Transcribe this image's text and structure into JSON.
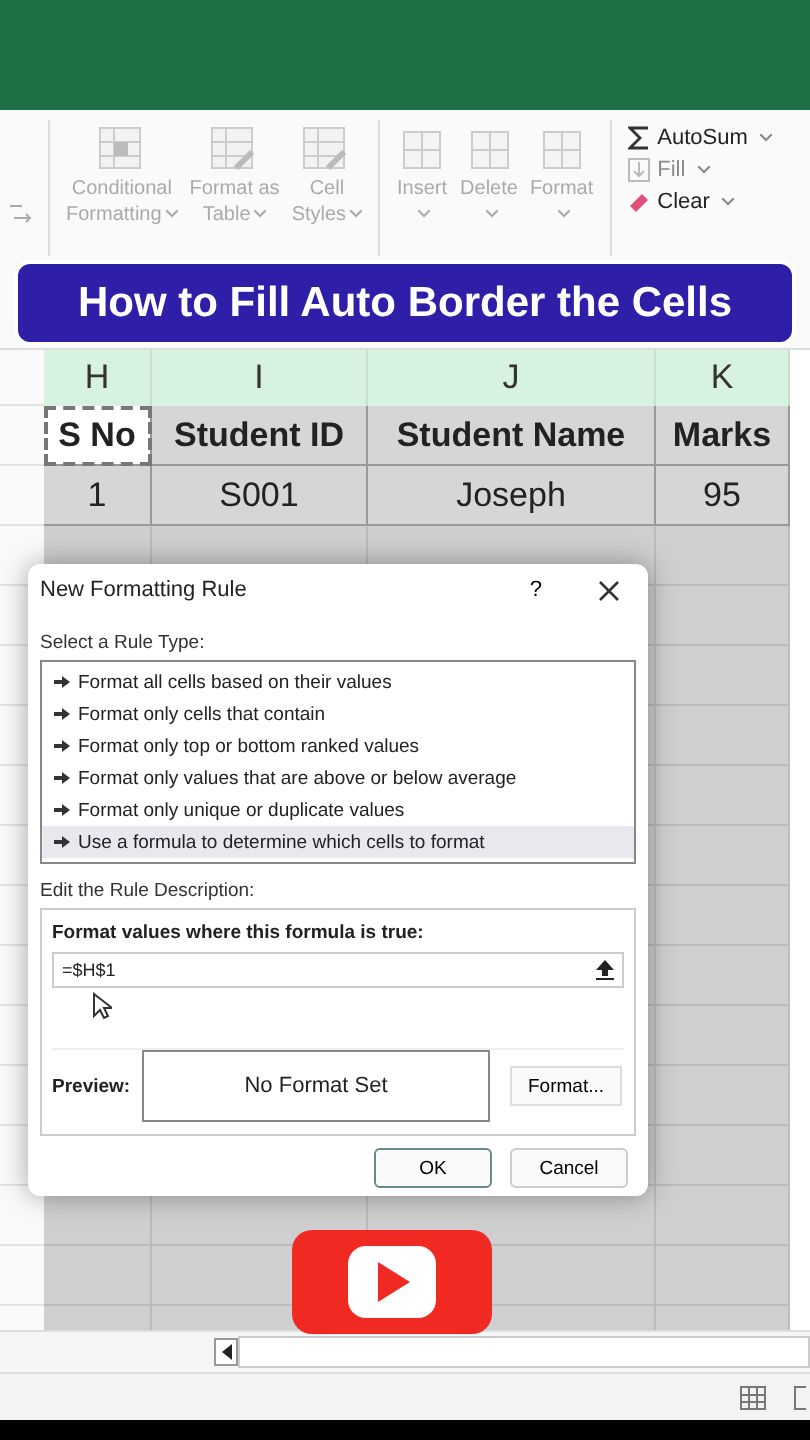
{
  "ribbon": {
    "styles": [
      {
        "label": "Conditional",
        "label2": "Formatting",
        "dropdown": true
      },
      {
        "label": "Format as",
        "label2": "Table",
        "dropdown": true
      },
      {
        "label": "Cell",
        "label2": "Styles",
        "dropdown": true
      }
    ],
    "cells": [
      {
        "label": "Insert",
        "dropdown": true
      },
      {
        "label": "Delete",
        "dropdown": true
      },
      {
        "label": "Format",
        "dropdown": true
      }
    ],
    "editing": [
      {
        "kind": "autosum",
        "label": "AutoSum",
        "disabled": false,
        "dropdown": true
      },
      {
        "kind": "fill",
        "label": "Fill",
        "disabled": true,
        "dropdown": true
      },
      {
        "kind": "clear",
        "label": "Clear",
        "disabled": false,
        "dropdown": true
      }
    ]
  },
  "banner": {
    "title": "How to Fill Auto Border the Cells"
  },
  "sheet": {
    "columns": [
      "H",
      "I",
      "J",
      "K"
    ],
    "rows": [
      {
        "header": true,
        "cells": [
          {
            "text": "S No",
            "marked": true
          },
          {
            "text": "Student ID",
            "marked": false
          },
          {
            "text": "Student Name",
            "marked": false
          },
          {
            "text": "Marks",
            "marked": false
          }
        ]
      },
      {
        "header": false,
        "cells": [
          {
            "text": "1",
            "marked": false
          },
          {
            "text": "S001",
            "marked": false
          },
          {
            "text": "Joseph",
            "marked": false
          },
          {
            "text": "95",
            "marked": false
          }
        ]
      }
    ]
  },
  "dialog": {
    "title": "New Formatting Rule",
    "help": "?",
    "rule_type_label": "Select a Rule Type:",
    "rule_types": [
      {
        "label": "Format all cells based on their values",
        "selected": false
      },
      {
        "label": "Format only cells that contain",
        "selected": false
      },
      {
        "label": "Format only top or bottom ranked values",
        "selected": false
      },
      {
        "label": "Format only values that are above or below average",
        "selected": false
      },
      {
        "label": "Format only unique or duplicate values",
        "selected": false
      },
      {
        "label": "Use a formula to determine which cells to format",
        "selected": true
      }
    ],
    "description_label": "Edit the Rule Description:",
    "formula_label": "Format values where this formula is true:",
    "formula": "=$H$1",
    "preview_label": "Preview:",
    "preview_text": "No Format Set",
    "format_button": "Format...",
    "ok": "OK",
    "cancel": "Cancel"
  }
}
